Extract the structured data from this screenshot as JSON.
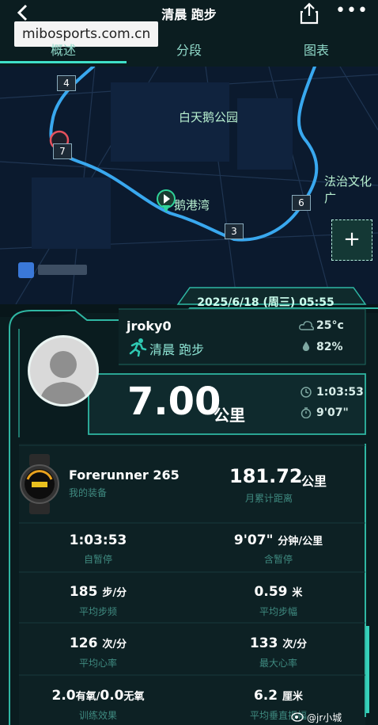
{
  "header": {
    "title": "清晨 跑步",
    "watermark": "mibosports.com.cn",
    "tabs": [
      "概述",
      "分段",
      "图表"
    ],
    "back_icon": "chevron-left-icon",
    "share_icon": "share-icon",
    "more_icon": "more-icon",
    "more_glyph": "•••"
  },
  "map": {
    "park_label": "白天鹅公园",
    "bay_label": "鹅港湾",
    "culture_label": "法治文化广",
    "markers": [
      "4",
      "7",
      "6",
      "3"
    ],
    "add_glyph": "+",
    "route_color": "#39a8ef"
  },
  "activity": {
    "datetime": "2025/6/18 (周三) 05:55",
    "user": "jroky0",
    "type": "清晨 跑步",
    "temperature": "25°c",
    "humidity": "82%",
    "distance": "7.00",
    "distance_unit": "公里",
    "duration": "1:03:53",
    "pace": "9'07\""
  },
  "device": {
    "name": "Forerunner 265",
    "subtitle": "我的装备",
    "month_value": "181.72",
    "month_unit": "公里",
    "month_label": "月累计距离"
  },
  "stats": [
    {
      "left_value": "1:03:53",
      "left_unit": "",
      "left_label": "自暂停",
      "right_value": "9'07\"",
      "right_unit": "分钟/公里",
      "right_label": "含暂停"
    },
    {
      "left_value": "185",
      "left_unit": "步/分",
      "left_label": "平均步频",
      "right_value": "0.59",
      "right_unit": "米",
      "right_label": "平均步幅"
    },
    {
      "left_value": "126",
      "left_unit": "次/分",
      "left_label": "平均心率",
      "right_value": "133",
      "right_unit": "次/分",
      "right_label": "最大心率"
    },
    {
      "left_value": "2.0",
      "left_unit": "有氧/",
      "left_value2": "0.0",
      "left_unit2": "无氧",
      "left_label": "训练效果",
      "right_value": "6.2",
      "right_unit": "厘米",
      "right_label": "平均垂直振幅"
    }
  ],
  "footer": {
    "weibo": "@jr小城"
  },
  "colors": {
    "accent": "#3fe0c8",
    "frame": "#2fb7a3",
    "background": "#08161a"
  }
}
